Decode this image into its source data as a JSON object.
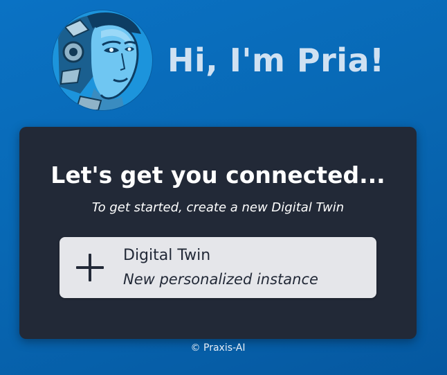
{
  "header": {
    "avatar_icon": "robot-woman-portrait",
    "greeting": "Hi, I'm Pria!"
  },
  "card": {
    "title": "Let's get you connected...",
    "subtitle": "To get started, create a new Digital Twin",
    "digital_twin_button": {
      "icon": "plus-icon",
      "label": "Digital Twin",
      "description": "New personalized instance"
    }
  },
  "footer": {
    "copyright": "© Praxis-AI"
  },
  "colors": {
    "background": "#0868b4",
    "card": "#222937",
    "button": "#e5e6ea",
    "greeting_text": "#cfe1f2"
  }
}
